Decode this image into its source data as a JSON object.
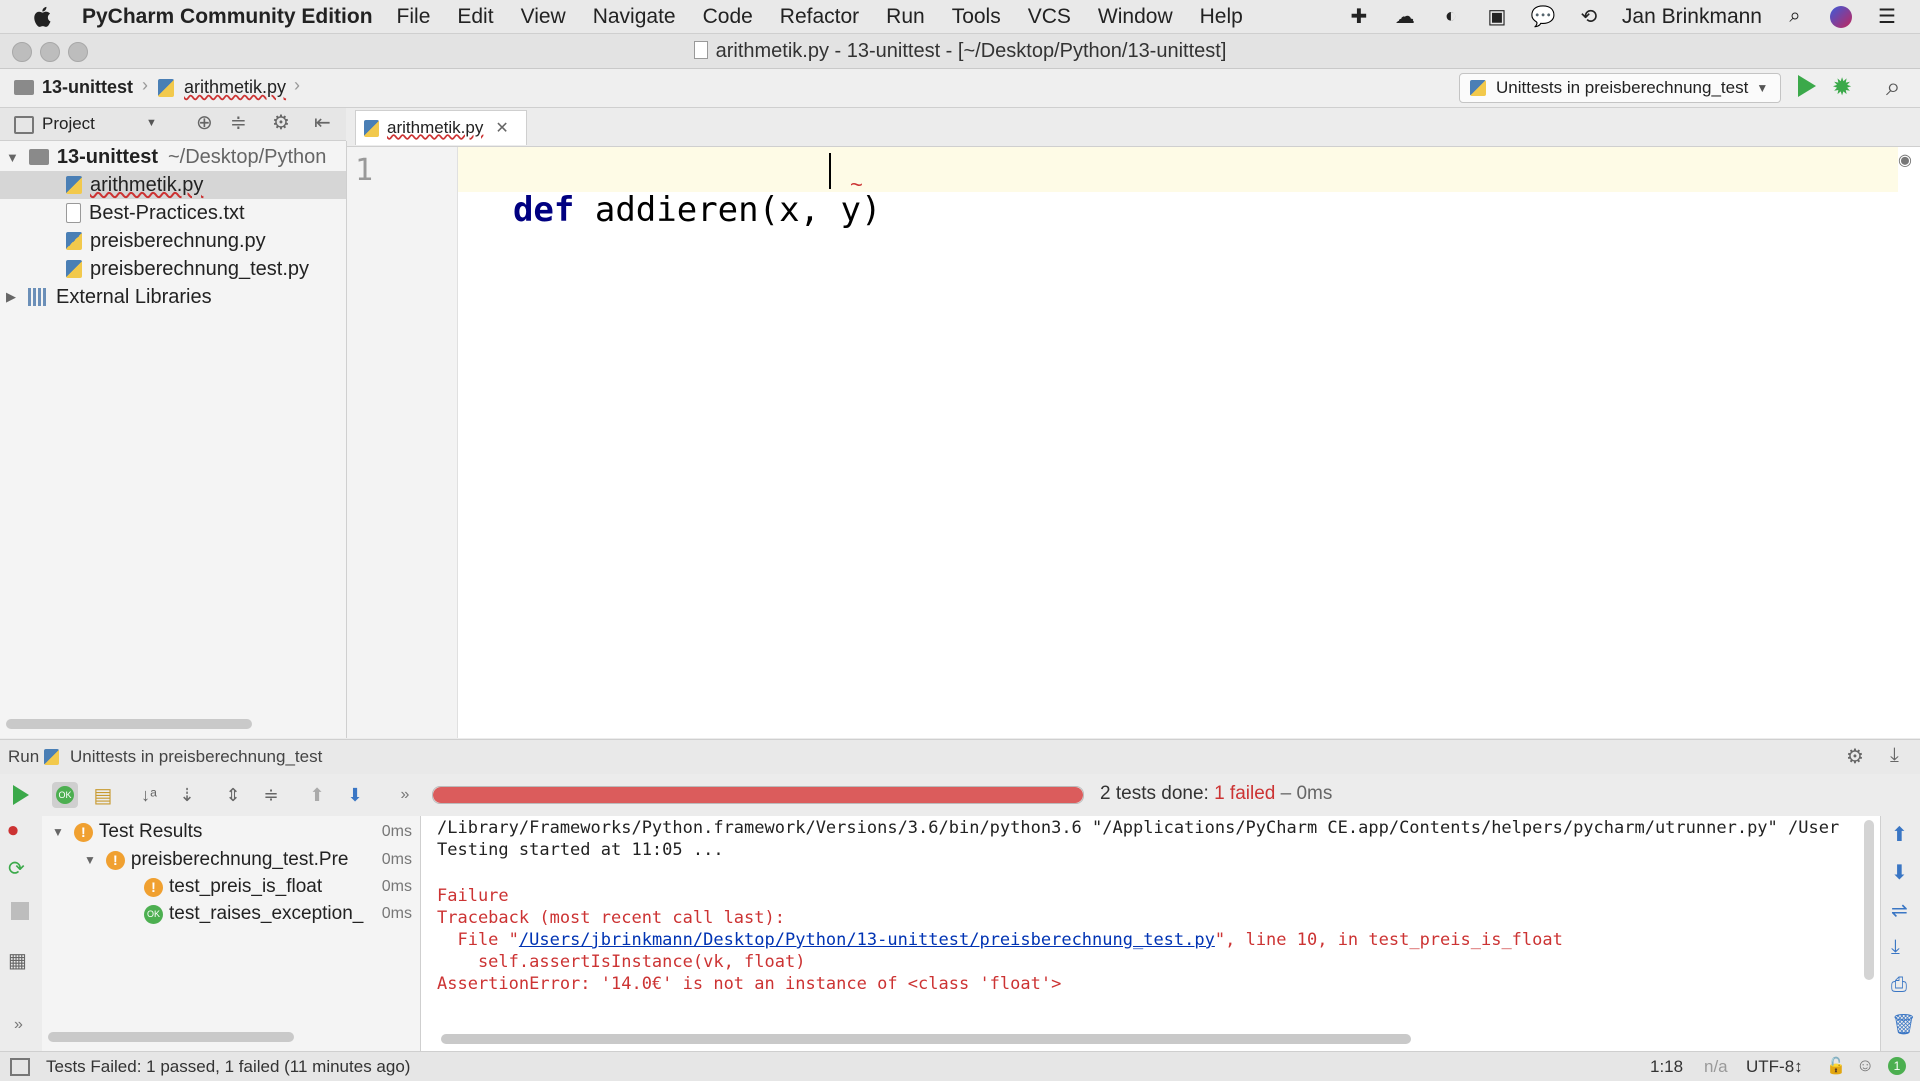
{
  "menubar": {
    "app_name": "PyCharm Community Edition",
    "items": [
      "File",
      "Edit",
      "View",
      "Navigate",
      "Code",
      "Refactor",
      "Run",
      "Tools",
      "VCS",
      "Window",
      "Help"
    ],
    "user": "Jan Brinkmann"
  },
  "window": {
    "title": "arithmetik.py - 13-unittest - [~/Desktop/Python/13-unittest]"
  },
  "navbar": {
    "crumb_project": "13-unittest",
    "crumb_file": "arithmetik.py",
    "run_config": "Unittests in preisberechnung_test"
  },
  "project": {
    "header": "Project",
    "root_name": "13-unittest",
    "root_path": "~/Desktop/Python",
    "files": [
      "arithmetik.py",
      "Best-Practices.txt",
      "preisberechnung.py",
      "preisberechnung_test.py"
    ],
    "external": "External Libraries"
  },
  "editor": {
    "tab": "arithmetik.py",
    "line_number": "1",
    "kw": "def",
    "rest": " addieren(x, y)"
  },
  "run": {
    "label": "Run",
    "config": "Unittests in preisberechnung_test",
    "progress_fraction": 1.0,
    "summary_prefix": "2 tests done: ",
    "summary_failed": "1 failed",
    "summary_suffix": " – 0ms",
    "results": {
      "root": "Test Results",
      "root_time": "0ms",
      "suite": "preisberechnung_test.Pre",
      "suite_time": "0ms",
      "tests": [
        {
          "name": "test_preis_is_float",
          "time": "0ms",
          "status": "failed"
        },
        {
          "name": "test_raises_exception_",
          "time": "0ms",
          "status": "passed"
        }
      ]
    },
    "console": {
      "line1": "/Library/Frameworks/Python.framework/Versions/3.6/bin/python3.6 \"/Applications/PyCharm CE.app/Contents/helpers/pycharm/utrunner.py\" /User",
      "line2": "Testing started at 11:05 ...",
      "line3": "Failure",
      "line4": "Traceback (most recent call last):",
      "line5_pre": "  File \"",
      "line5_link": "/Users/jbrinkmann/Desktop/Python/13-unittest/preisberechnung_test.py",
      "line5_post": "\", line 10, in test_preis_is_float",
      "line6": "    self.assertIsInstance(vk, float)",
      "line7": "AssertionError: '14.0€' is not an instance of <class 'float'>"
    }
  },
  "statusbar": {
    "message": "Tests Failed: 1 passed, 1 failed (11 minutes ago)",
    "position": "1:18",
    "na": "n/a",
    "encoding": "UTF-8↕"
  },
  "colors": {
    "keyword": "#000080",
    "error": "#cc3333",
    "progress": "#db5c5c",
    "ok": "#4caf50",
    "warn": "#f0a030",
    "link": "#0033b3"
  }
}
